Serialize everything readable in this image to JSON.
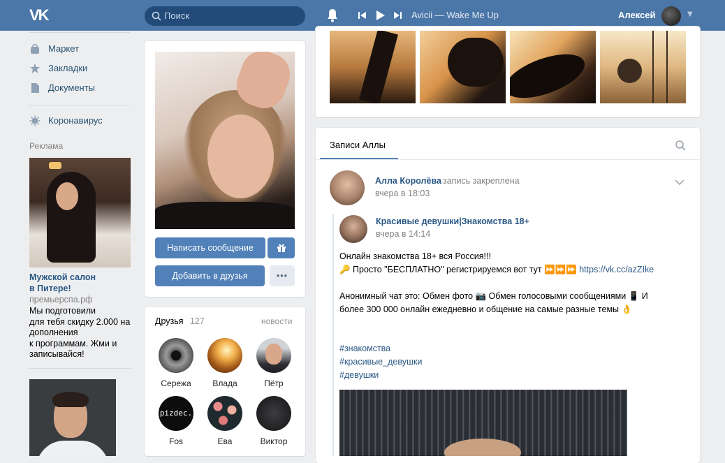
{
  "topbar": {
    "logo": "VK",
    "search_placeholder": "Поиск",
    "track": "Avicii — Wake Me Up",
    "user_name": "Алексей"
  },
  "left_nav": {
    "items": [
      {
        "label": "Маркет",
        "icon": "market-bag-icon"
      },
      {
        "label": "Закладки",
        "icon": "star-icon"
      },
      {
        "label": "Документы",
        "icon": "document-icon"
      },
      {
        "label": "Коронавирус",
        "icon": "virus-icon"
      }
    ],
    "ads_label": "Реклама",
    "ad": {
      "title": "Мужской салон\nв Питере!",
      "domain": "премьерспа.рф",
      "text": "Мы подготовили\nдля тебя скидку 2.000 на\nдополнения\nк программам. Жми и\nзаписывайся!"
    }
  },
  "profile": {
    "write_message": "Написать сообщение",
    "add_friend": "Добавить в друзья",
    "more": "•••"
  },
  "friends": {
    "title": "Друзья",
    "count": "127",
    "news": "новости",
    "items": [
      {
        "name": "Сережа"
      },
      {
        "name": "Влада"
      },
      {
        "name": "Пётр"
      },
      {
        "name": "Fos",
        "avatar_text": "pizdec."
      },
      {
        "name": "Ева"
      },
      {
        "name": "Виктор"
      }
    ]
  },
  "wall": {
    "tab": "Записи Аллы",
    "post": {
      "author": "Алла Королёва",
      "pinned": "запись закреплена",
      "time": "вчера в 18:03"
    },
    "repost": {
      "author": "Красивые девушки|Знакомства 18+",
      "time": "вчера в 14:14",
      "line1": "Онлайн знакомства 18+ вся Россия!!!",
      "line2": "🔑 Просто \"БЕСПЛАТНО\" регистрируемся вот тут ⏩⏩⏩",
      "link": "https://vk.cc/azZIke",
      "line3": "Анонимный чат это: Обмен фото 📷 Обмен голосовыми сообщениями 📱 И",
      "line4": "более 300 000 онлайн ежедневно и общение на самые разные темы 👌",
      "tags": [
        "#знакомства",
        "#красивые_девушки",
        "#девушки"
      ]
    }
  },
  "colors": {
    "header": "#4a76a8",
    "link": "#2a5885",
    "button": "#5181b8",
    "background": "#edeef0"
  }
}
